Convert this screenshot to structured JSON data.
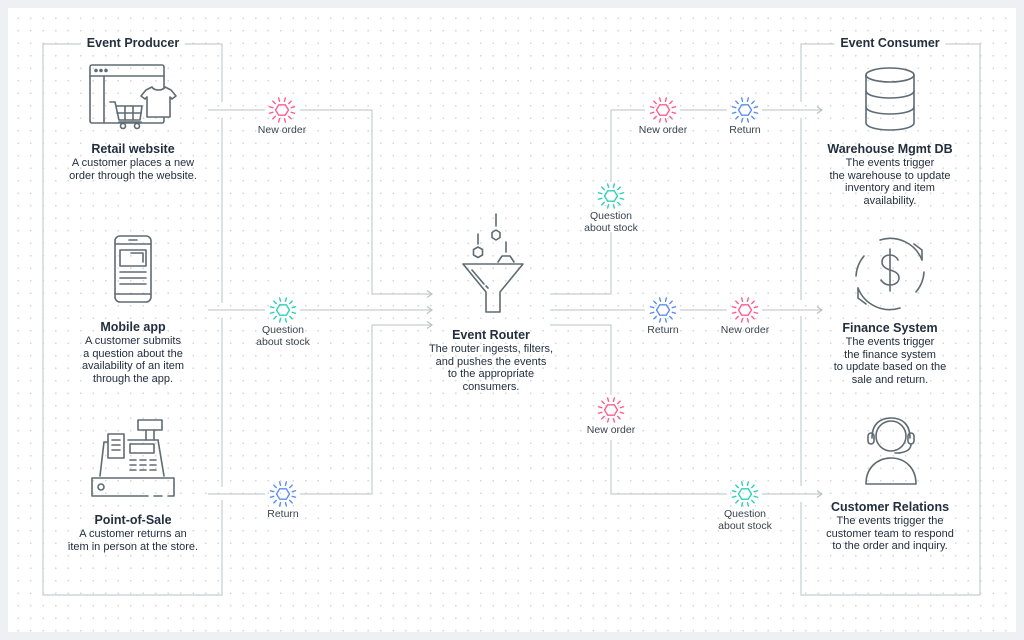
{
  "producer": {
    "title": "Event Producer",
    "nodes": [
      {
        "icon": "retail-website-icon",
        "name": "Retail website",
        "desc": [
          "A customer places a new",
          "order through the website."
        ]
      },
      {
        "icon": "mobile-app-icon",
        "name": "Mobile app",
        "desc": [
          "A customer submits",
          "a question about the",
          "availability of an item",
          "through the app."
        ]
      },
      {
        "icon": "cash-register-icon",
        "name": "Point-of-Sale",
        "desc": [
          "A customer returns an",
          "item in person at the store."
        ]
      }
    ]
  },
  "router": {
    "icon": "funnel-filter-icon",
    "name": "Event Router",
    "desc": [
      "The router ingests, filters,",
      "and pushes the events",
      "to the appropriate",
      "consumers."
    ]
  },
  "consumer": {
    "title": "Event Consumer",
    "nodes": [
      {
        "icon": "database-icon",
        "name": "Warehouse Mgmt DB",
        "desc": [
          "The events trigger",
          "the warehouse to update",
          "inventory and item",
          "availability."
        ]
      },
      {
        "icon": "finance-dollar-cycle-icon",
        "name": "Finance System",
        "desc": [
          "The events trigger",
          "the finance system",
          "to update based on the",
          "sale and return."
        ]
      },
      {
        "icon": "headset-agent-icon",
        "name": "Customer Relations",
        "desc": [
          "The events trigger the",
          "customer team to respond",
          "to the order and inquiry."
        ]
      }
    ]
  },
  "event_types": {
    "new_order": {
      "label": [
        "New order"
      ],
      "color": "#ff5c8d"
    },
    "question": {
      "label": [
        "Question",
        "about stock"
      ],
      "color": "#2bd1b6"
    },
    "return": {
      "label": [
        "Return"
      ],
      "color": "#5b8def"
    }
  },
  "events": {
    "in_retail": {
      "type": "new_order",
      "label": [
        "New order"
      ]
    },
    "in_mobile": {
      "type": "question",
      "label": [
        "Question",
        "about stock"
      ]
    },
    "in_pos": {
      "type": "return",
      "label": [
        "Return"
      ]
    },
    "out_wh_question": {
      "type": "question",
      "label": [
        "Question",
        "about stock"
      ]
    },
    "out_wh_new_order": {
      "type": "new_order",
      "label": [
        "New order"
      ]
    },
    "out_wh_return": {
      "type": "return",
      "label": [
        "Return"
      ]
    },
    "out_fin_return": {
      "type": "return",
      "label": [
        "Return"
      ]
    },
    "out_fin_new_order": {
      "type": "new_order",
      "label": [
        "New order"
      ]
    },
    "out_cr_new_order": {
      "type": "new_order",
      "label": [
        "New order"
      ]
    },
    "out_cr_question": {
      "type": "question",
      "label": [
        "Question",
        "about stock"
      ]
    }
  },
  "colors": {
    "wire": "#c5ced2",
    "icon": "#5f6b72",
    "text": "#232f3e",
    "new_order": "#ff5c8d",
    "question": "#2bd1b6",
    "return": "#5b8def"
  }
}
